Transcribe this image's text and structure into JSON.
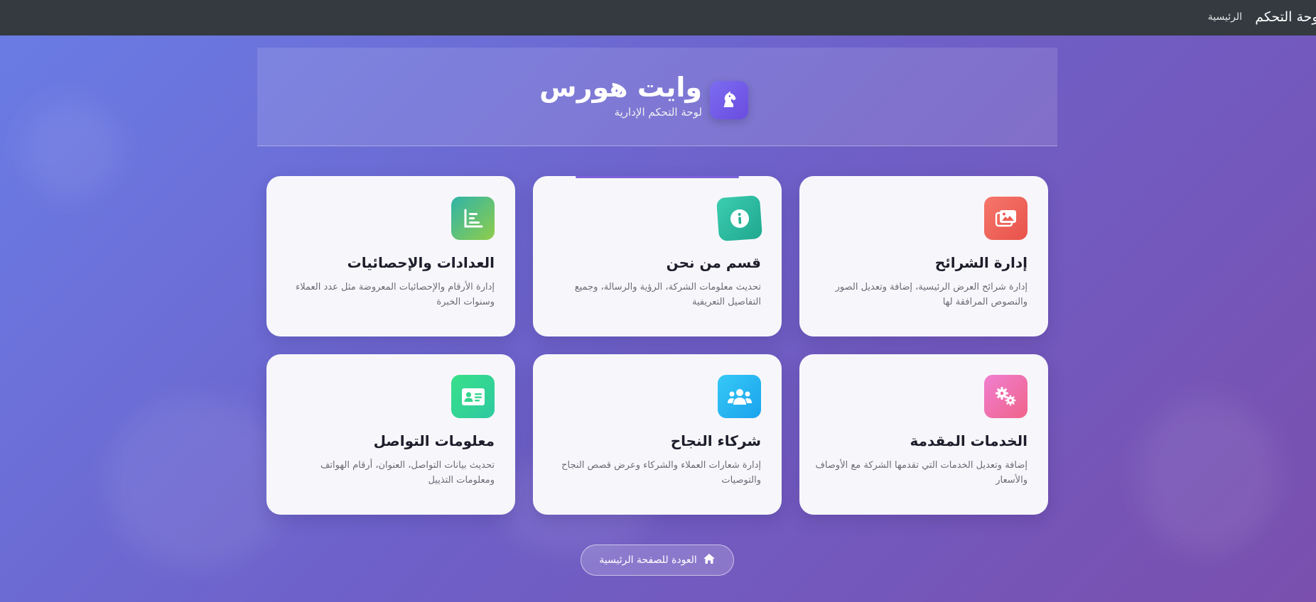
{
  "navbar": {
    "brand": "لوحة التحكم",
    "home_link": "الرئيسية"
  },
  "hero": {
    "title": "وايت هورس",
    "subtitle": "لوحة التحكم الإدارية",
    "logo_icon": "horse-icon"
  },
  "cards": [
    {
      "title": "إدارة الشرائح",
      "description": "إدارة شرائح العرض الرئيسية، إضافة وتعديل الصور والنصوص المرافقة لها",
      "icon": "images-icon",
      "color": "#f0645a"
    },
    {
      "title": "قسم من نحن",
      "description": "تحديث معلومات الشركة، الرؤية والرسالة، وجميع التفاصيل التعريفية",
      "icon": "info-icon",
      "color": "#2fb8a3"
    },
    {
      "title": "العدادات والإحصائيات",
      "description": "إدارة الأرقام والإحصائيات المعروضة مثل عدد العملاء وسنوات الخبرة",
      "icon": "chart-icon",
      "color": "#3fb59a"
    },
    {
      "title": "الخدمات المقدمة",
      "description": "إضافة وتعديل الخدمات التي تقدمها الشركة مع الأوصاف والأسعار",
      "icon": "gears-icon",
      "color": "#ee6ab0"
    },
    {
      "title": "شركاء النجاح",
      "description": "إدارة شعارات العملاء والشركاء وعرض قصص النجاح والتوصيات",
      "icon": "users-icon",
      "color": "#22b8f0"
    },
    {
      "title": "معلومات التواصل",
      "description": "تحديث بيانات التواصل، العنوان، أرقام الهواتف ومعلومات التذييل",
      "icon": "contact-card-icon",
      "color": "#33d68c"
    }
  ],
  "back_button": {
    "label": "العودة للصفحة الرئيسية",
    "icon": "home-icon"
  }
}
